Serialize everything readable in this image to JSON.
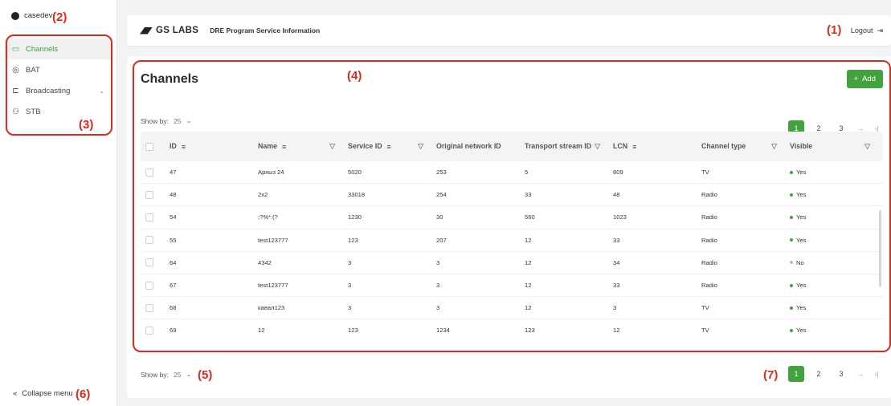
{
  "user": {
    "name": "casedev"
  },
  "sidebar": {
    "items": [
      {
        "label": "Channels",
        "icon": "tv-icon",
        "glyph": "▭",
        "active": true
      },
      {
        "label": "BAT",
        "icon": "broadcast-icon",
        "glyph": "◎",
        "active": false
      },
      {
        "label": "Broadcasting",
        "icon": "satellite-icon",
        "glyph": "⊏",
        "active": false,
        "chevron": "⌄"
      },
      {
        "label": "STB",
        "icon": "users-icon",
        "glyph": "⚇",
        "active": false
      }
    ],
    "collapse_label": "Collapse menu",
    "collapse_glyph": "«"
  },
  "header": {
    "logo_text": "GS LABS",
    "title": "DRE Program Service Information",
    "logout_label": "Logout",
    "logout_glyph": "⇥"
  },
  "main": {
    "page_title": "Channels",
    "add_label": "Add",
    "add_glyph": "+",
    "show_by_label": "Show by:",
    "show_by_value": "25",
    "show_by_glyph": "⌄",
    "pagination": {
      "pages": [
        "1",
        "2",
        "3"
      ],
      "current": "1",
      "next": "→",
      "last": "›|"
    },
    "columns": {
      "id": "ID",
      "name": "Name",
      "service_id": "Service ID",
      "onid": "Original network ID",
      "tsid": "Transport stream ID",
      "lcn": "LCN",
      "type": "Channel type",
      "visible": "Visible"
    },
    "rows": [
      {
        "id": "47",
        "name": "Архыз 24",
        "service_id": "5020",
        "onid": "253",
        "tsid": "5",
        "lcn": "809",
        "type": "TV",
        "visible": "Yes"
      },
      {
        "id": "48",
        "name": "2x2",
        "service_id": "33018",
        "onid": "254",
        "tsid": "33",
        "lcn": "48",
        "type": "Radio",
        "visible": "Yes"
      },
      {
        "id": "54",
        "name": ";?%*:(?",
        "service_id": "1230",
        "onid": "30",
        "tsid": "560",
        "lcn": "1023",
        "type": "Radio",
        "visible": "Yes"
      },
      {
        "id": "55",
        "name": "test123777",
        "service_id": "123",
        "onid": "207",
        "tsid": "12",
        "lcn": "33",
        "type": "Radio",
        "visible": "Yes"
      },
      {
        "id": "64",
        "name": "4342",
        "service_id": "3",
        "onid": "3",
        "tsid": "12",
        "lcn": "34",
        "type": "Radio",
        "visible": "No"
      },
      {
        "id": "67",
        "name": "test123777",
        "service_id": "3",
        "onid": "3",
        "tsid": "12",
        "lcn": "33",
        "type": "Radio",
        "visible": "Yes"
      },
      {
        "id": "68",
        "name": "каеал123",
        "service_id": "3",
        "onid": "3",
        "tsid": "12",
        "lcn": "3",
        "type": "TV",
        "visible": "Yes"
      },
      {
        "id": "69",
        "name": "12",
        "service_id": "123",
        "onid": "1234",
        "tsid": "123",
        "lcn": "12",
        "type": "TV",
        "visible": "Yes"
      }
    ]
  },
  "colors": {
    "accent": "#42a33e",
    "visible_yes": "#42a33e",
    "visible_no": "#bbbbbb",
    "annotation": "#e0281d"
  },
  "annotations": [
    "(1)",
    "(2)",
    "(3)",
    "(4)",
    "(5)",
    "(6)",
    "(7)"
  ]
}
